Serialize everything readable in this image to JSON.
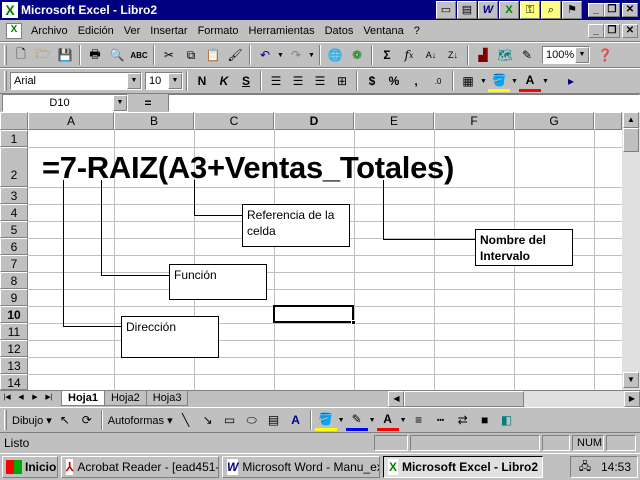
{
  "window": {
    "title": "Microsoft Excel - Libro2",
    "app_icon": "excel-icon"
  },
  "menu": {
    "items": [
      "Archivo",
      "Edición",
      "Ver",
      "Insertar",
      "Formato",
      "Herramientas",
      "Datos",
      "Ventana",
      "?"
    ]
  },
  "toolbar": {
    "zoom": "100%"
  },
  "format_toolbar": {
    "font": "Arial",
    "size": "10",
    "bold": "N",
    "italic": "K",
    "underline": "S",
    "currency": "$",
    "percent": "%"
  },
  "formula_bar": {
    "name_box": "D10",
    "equals": "=",
    "content": ""
  },
  "grid": {
    "columns": [
      "A",
      "B",
      "C",
      "D",
      "E",
      "F",
      "G"
    ],
    "rows": [
      "1",
      "2",
      "3",
      "4",
      "5",
      "6",
      "7",
      "8",
      "9",
      "10",
      "11",
      "12",
      "13",
      "14"
    ],
    "active_column": "D",
    "active_row": "10",
    "cell_a2": "=7-RAIZ(A3+Ventas_Totales)"
  },
  "callouts": {
    "referencia": "Referencia de la celda",
    "nombre_intervalo": "Nombre del Intervalo",
    "funcion": "Función",
    "direccion": "Dirección"
  },
  "sheets": [
    "Hoja1",
    "Hoja2",
    "Hoja3"
  ],
  "drawing": {
    "dibujo": "Dibujo",
    "autoformas": "Autoformas"
  },
  "status": {
    "text": "Listo",
    "num": "NUM"
  },
  "taskbar": {
    "start": "Inicio",
    "tasks": [
      "Acrobat Reader - [ead451-...",
      "Microsoft Word - Manu_ex...",
      "Microsoft Excel - Libro2"
    ],
    "clock": "14:53"
  },
  "colors": {
    "title_bar": "#000080",
    "window_bg": "#c0c0c0"
  }
}
